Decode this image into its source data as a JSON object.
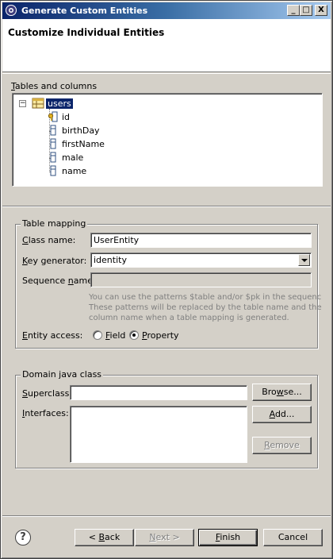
{
  "window": {
    "title": "Generate Custom Entities",
    "minimize_glyph": "_",
    "maximize_glyph": "□",
    "close_glyph": "X"
  },
  "banner": {
    "title": "Customize Individual Entities"
  },
  "tables": {
    "label": "Tables and columns",
    "label_mnemonic": "T",
    "label_rest": "ables and columns",
    "table_name": "users",
    "expander_glyph": "−",
    "columns": [
      {
        "name": "id",
        "icon": "key-column-icon"
      },
      {
        "name": "birthDay",
        "icon": "column-icon"
      },
      {
        "name": "firstName",
        "icon": "column-icon"
      },
      {
        "name": "male",
        "icon": "column-icon"
      },
      {
        "name": "name",
        "icon": "column-icon"
      }
    ]
  },
  "table_mapping": {
    "title": "Table mapping",
    "class_name": {
      "mnemonic": "C",
      "rest": "lass name:",
      "value": "UserEntity"
    },
    "key_generator": {
      "mnemonic": "K",
      "rest": "ey generator:",
      "value": "identity"
    },
    "sequence_name": {
      "label_start": "Sequence ",
      "mnemonic": "n",
      "rest": "ame:",
      "value": ""
    },
    "hint_lines": [
      "You can use the patterns $table and/or $pk in the sequenc",
      "These patterns will be replaced by the table name and the",
      "column name when a table mapping is generated."
    ],
    "entity_access": {
      "mnemonic": "E",
      "rest": "ntity access:",
      "options": [
        {
          "mnemonic": "F",
          "rest": "ield",
          "checked": false
        },
        {
          "mnemonic": "P",
          "rest": "roperty",
          "checked": true
        }
      ]
    }
  },
  "domain_class": {
    "title": "Domain java class",
    "superclass": {
      "mnemonic": "S",
      "rest": "uperclass:",
      "value": ""
    },
    "browse": {
      "prefix": "Bro",
      "mnemonic": "w",
      "rest": "se..."
    },
    "interfaces": {
      "mnemonic": "I",
      "rest": "nterfaces:"
    },
    "add": {
      "mnemonic": "A",
      "rest": "dd..."
    },
    "remove": {
      "mnemonic": "R",
      "rest": "emove"
    }
  },
  "footer": {
    "help_glyph": "?",
    "back": {
      "prefix": "< ",
      "mnemonic": "B",
      "rest": "ack"
    },
    "next": {
      "mnemonic": "N",
      "rest": "ext >"
    },
    "finish": {
      "mnemonic": "F",
      "rest": "inish"
    },
    "cancel": "Cancel"
  },
  "colors": {
    "selection": "#0a246a",
    "titlebar_start": "#0a246a",
    "titlebar_end": "#a6caf0",
    "dialog": "#d4d0c8"
  }
}
